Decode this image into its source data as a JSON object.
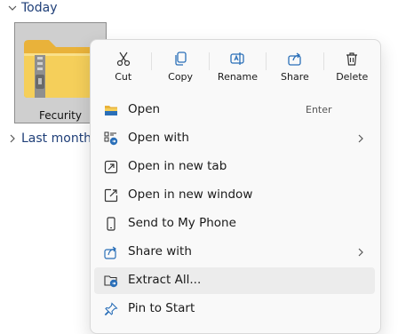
{
  "groups": {
    "today": "Today",
    "last_month": "Last month"
  },
  "file": {
    "name": "Fecurity",
    "type_icon": "zip-folder-icon"
  },
  "context_menu": {
    "toolbar": [
      {
        "label": "Cut",
        "icon": "scissors-icon"
      },
      {
        "label": "Copy",
        "icon": "copy-icon"
      },
      {
        "label": "Rename",
        "icon": "rename-icon"
      },
      {
        "label": "Share",
        "icon": "share-icon"
      },
      {
        "label": "Delete",
        "icon": "trash-icon"
      }
    ],
    "items": [
      {
        "label": "Open",
        "hint": "Enter",
        "icon": "folder-icon"
      },
      {
        "label": "Open with",
        "icon": "open-with-icon",
        "submenu": true
      },
      {
        "label": "Open in new tab",
        "icon": "new-tab-icon"
      },
      {
        "label": "Open in new window",
        "icon": "new-window-icon"
      },
      {
        "label": "Send to My Phone",
        "icon": "phone-icon"
      },
      {
        "label": "Share with",
        "icon": "share-with-icon",
        "submenu": true
      },
      {
        "label": "Extract All...",
        "icon": "extract-icon",
        "highlighted": true
      },
      {
        "label": "Pin to Start",
        "icon": "pin-icon"
      }
    ]
  },
  "colors": {
    "accent": "#1f3f78",
    "icon_blue": "#2a6fb8",
    "folder_yellow": "#f5c84c",
    "highlight": "#ececec"
  }
}
